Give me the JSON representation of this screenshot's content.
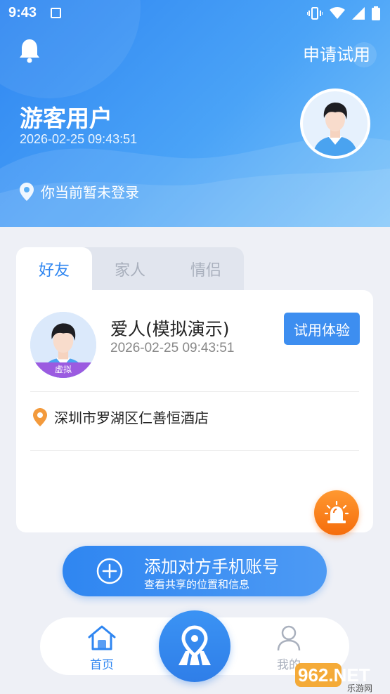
{
  "status_bar": {
    "time": "9:43"
  },
  "header": {
    "trial_link": "申请试用",
    "user_name": "游客用户",
    "timestamp": "2026-02-25 09:43:51",
    "login_status": "你当前暂未登录"
  },
  "tabs": [
    {
      "label": "好友",
      "active": true
    },
    {
      "label": "家人",
      "active": false
    },
    {
      "label": "情侣",
      "active": false
    }
  ],
  "contact": {
    "name": "爱人(模拟演示)",
    "timestamp": "2026-02-25 09:43:51",
    "badge": "虚拟",
    "trial_button": "试用体验",
    "address": "深圳市罗湖区仁善恒酒店"
  },
  "add_contact": {
    "title": "添加对方手机账号",
    "subtitle": "查看共享的位置和信息"
  },
  "bottom_nav": {
    "home_label": "首页",
    "me_label": "我的"
  },
  "watermark": {
    "text": "962.NET",
    "sub": "乐游网"
  },
  "colors": {
    "primary": "#2f86f1",
    "alarm": "#f57d18",
    "virtual_badge": "#9b5be0"
  }
}
